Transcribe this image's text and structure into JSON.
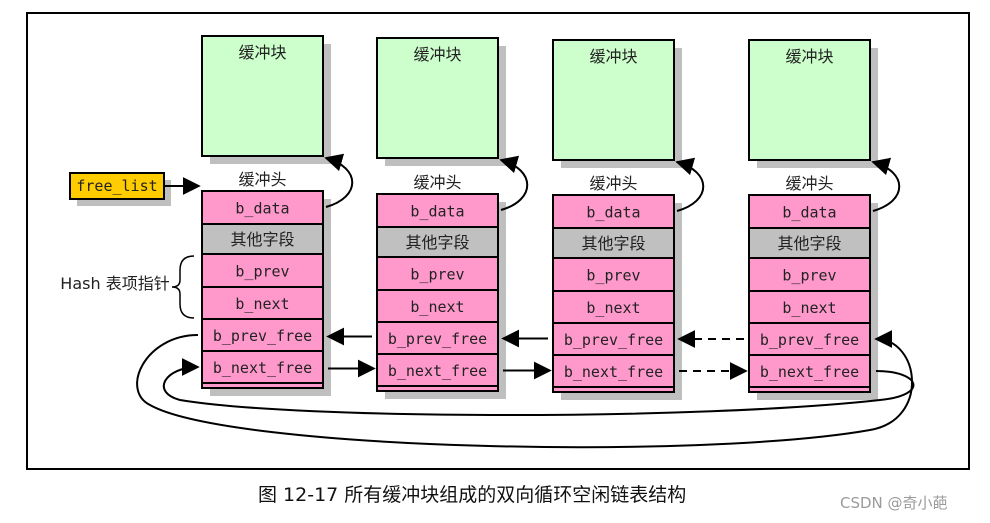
{
  "caption": "图 12-17 所有缓冲块组成的双向循环空闲链表结构",
  "watermark": "CSDN @奇小葩",
  "free_list_label": "free_list",
  "hash_label": "Hash 表项指针",
  "colors": {
    "block_fill": "#ccffcc",
    "field_fill": "#ff99cc",
    "other_fill": "#c0c0c0",
    "free_list_fill": "#ffcc00",
    "shadow": "#bfbfbf"
  },
  "buffers": [
    {
      "block_label": "缓冲块",
      "header_label": "缓冲头",
      "fields": [
        "b_data",
        "其他字段",
        "b_prev",
        "b_next",
        "b_prev_free",
        "b_next_free"
      ]
    },
    {
      "block_label": "缓冲块",
      "header_label": "缓冲头",
      "fields": [
        "b_data",
        "其他字段",
        "b_prev",
        "b_next",
        "b_prev_free",
        "b_next_free"
      ]
    },
    {
      "block_label": "缓冲块",
      "header_label": "缓冲头",
      "fields": [
        "b_data",
        "其他字段",
        "b_prev",
        "b_next",
        "b_prev_free",
        "b_next_free"
      ]
    },
    {
      "block_label": "缓冲块",
      "header_label": "缓冲头",
      "fields": [
        "b_data",
        "其他字段",
        "b_prev",
        "b_next",
        "b_prev_free",
        "b_next_free"
      ]
    }
  ],
  "links": [
    {
      "from": 1,
      "to": 0,
      "field": "b_prev_free",
      "style": "solid"
    },
    {
      "from": 2,
      "to": 1,
      "field": "b_prev_free",
      "style": "solid"
    },
    {
      "from": 3,
      "to": 2,
      "field": "b_prev_free",
      "style": "dashed"
    },
    {
      "from": 0,
      "to": 1,
      "field": "b_next_free",
      "style": "solid"
    },
    {
      "from": 1,
      "to": 2,
      "field": "b_next_free",
      "style": "solid"
    },
    {
      "from": 2,
      "to": 3,
      "field": "b_next_free",
      "style": "dashed"
    }
  ]
}
